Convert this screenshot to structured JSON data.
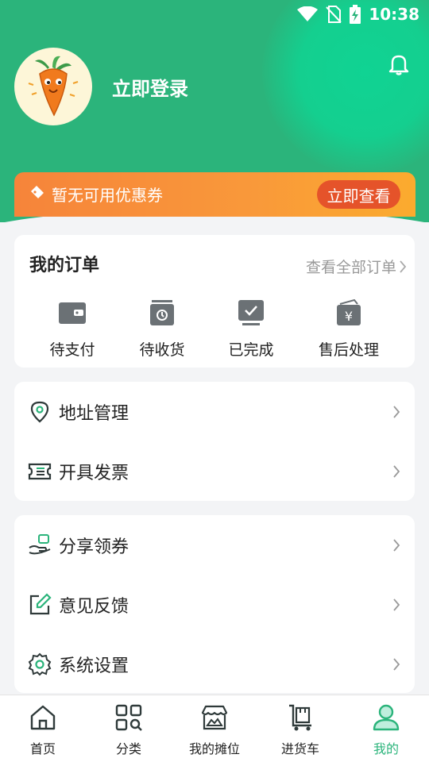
{
  "status_bar": {
    "time": "10:38"
  },
  "profile": {
    "login_text": "立即登录"
  },
  "coupon": {
    "text": "暂无可用优惠券",
    "button": "立即查看"
  },
  "orders": {
    "title": "我的订单",
    "view_all": "查看全部订单",
    "items": [
      {
        "label": "待支付",
        "icon": "wallet-icon"
      },
      {
        "label": "待收货",
        "icon": "package-clock-icon"
      },
      {
        "label": "已完成",
        "icon": "check-box-icon"
      },
      {
        "label": "售后处理",
        "icon": "yen-wallet-icon"
      }
    ]
  },
  "menu_group_1": [
    {
      "label": "地址管理",
      "icon": "location-pin-icon"
    },
    {
      "label": "开具发票",
      "icon": "invoice-icon"
    }
  ],
  "menu_group_2": [
    {
      "label": "分享领券",
      "icon": "share-coupon-icon"
    },
    {
      "label": "意见反馈",
      "icon": "edit-feedback-icon"
    },
    {
      "label": "系统设置",
      "icon": "settings-gear-icon"
    }
  ],
  "tabbar": [
    {
      "label": "首页",
      "icon": "home-icon"
    },
    {
      "label": "分类",
      "icon": "category-search-icon"
    },
    {
      "label": "我的摊位",
      "icon": "stall-icon"
    },
    {
      "label": "进货车",
      "icon": "cart-icon"
    },
    {
      "label": "我的",
      "icon": "user-icon",
      "active": true
    }
  ],
  "colors": {
    "brand": "#2bb47b",
    "coupon_btn": "#e5532a",
    "icon_gray": "#6b7175"
  }
}
